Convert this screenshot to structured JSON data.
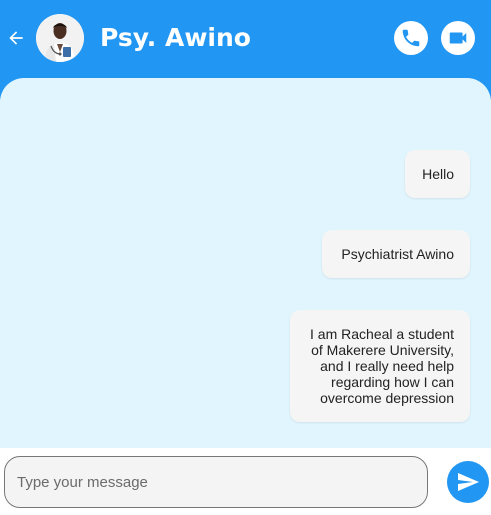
{
  "header": {
    "title": "Psy. Awino",
    "back_icon": "arrow-left-icon",
    "call_icon": "phone-icon",
    "video_icon": "video-camera-icon",
    "background_color": "#2196f3"
  },
  "messages": [
    {
      "text": "Hello"
    },
    {
      "text": "Psychiatrist Awino"
    },
    {
      "text": "I am Racheal a student of Makerere University, and I really need help regarding how I can overcome depression"
    }
  ],
  "composer": {
    "placeholder": "Type your message",
    "value": "",
    "send_icon": "send-icon"
  },
  "colors": {
    "accent": "#2196f3",
    "chat_background": "#e1f5fe",
    "bubble": "#f5f5f5"
  }
}
